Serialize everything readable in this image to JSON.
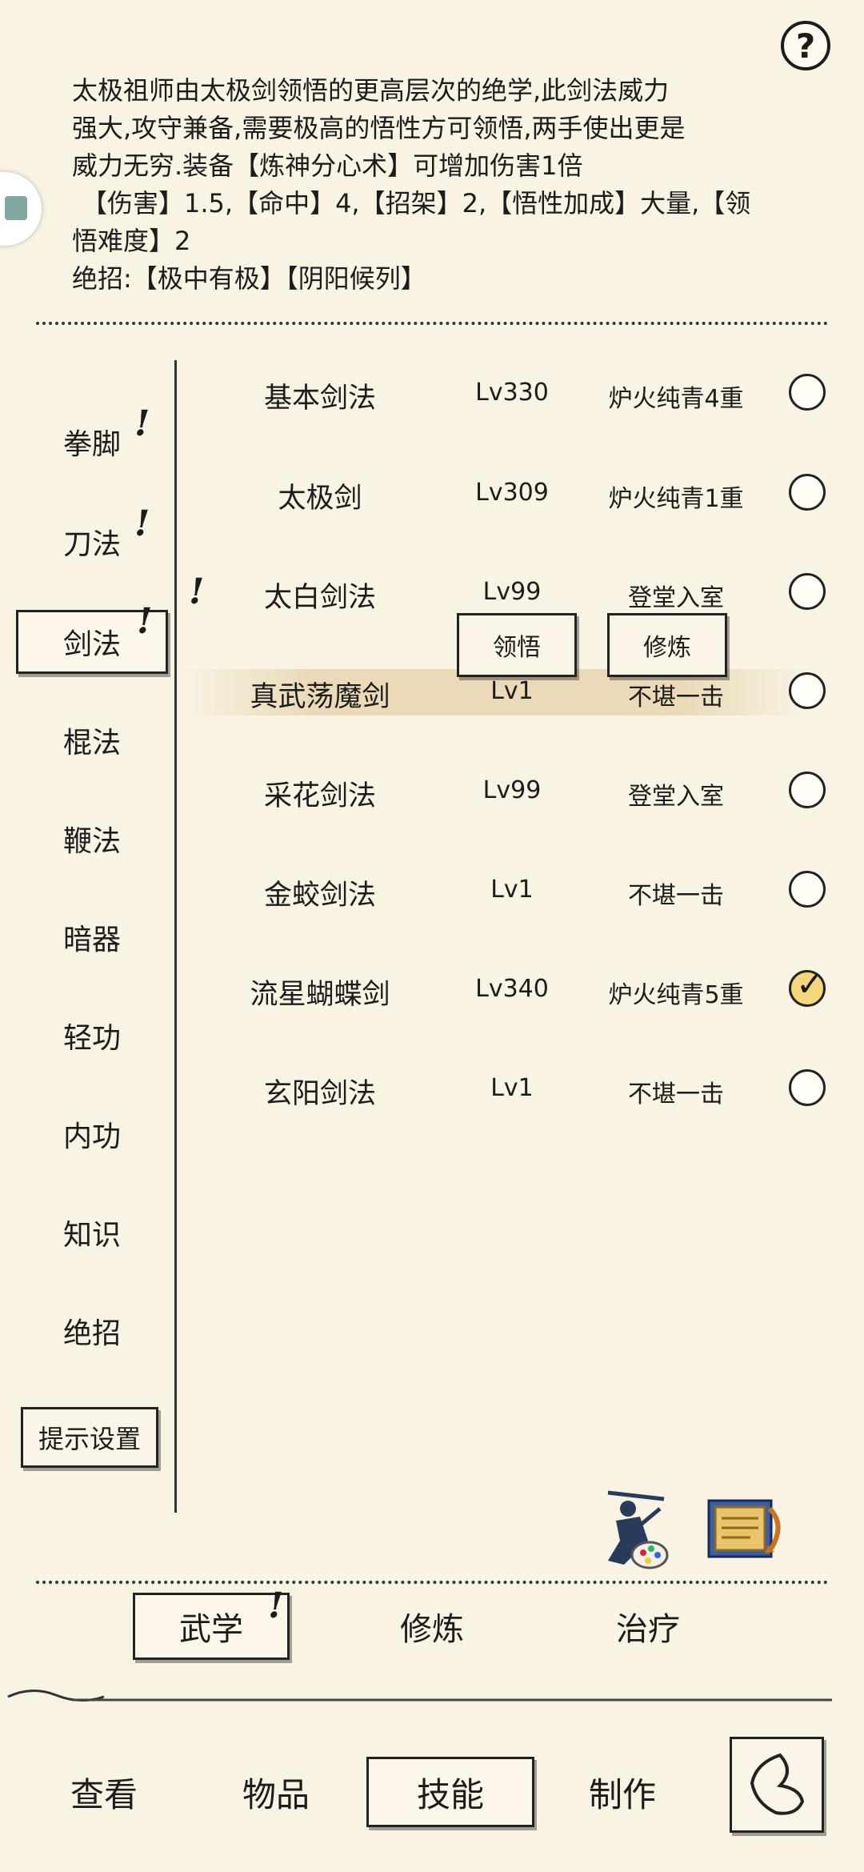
{
  "description": {
    "lines": [
      "太极祖师由太极剑领悟的更高层次的绝学,此剑法威力",
      "强大,攻守兼备,需要极高的悟性方可领悟,两手使出更是",
      "威力无穷.装备【炼神分心术】可增加伤害1倍",
      "【伤害】1.5,【命中】4,【招架】2,【悟性加成】大量,【领",
      "悟难度】2",
      "绝招:【极中有极】【阴阳候列】"
    ]
  },
  "help_label": "?",
  "nav": {
    "items": [
      {
        "label": "拳脚",
        "alert": "!"
      },
      {
        "label": "刀法",
        "alert": "!"
      },
      {
        "label": "剑法",
        "alert": "!",
        "active": true
      },
      {
        "label": "棍法"
      },
      {
        "label": "鞭法"
      },
      {
        "label": "暗器"
      },
      {
        "label": "轻功"
      },
      {
        "label": "内功"
      },
      {
        "label": "知识"
      },
      {
        "label": "绝招"
      }
    ],
    "tips_button": "提示设置"
  },
  "skills": [
    {
      "name": "基本剑法",
      "level": "Lv330",
      "stage": "炉火纯青4重",
      "equipped": false
    },
    {
      "name": "太极剑",
      "level": "Lv309",
      "stage": "炉火纯青1重",
      "equipped": false
    },
    {
      "name": "太白剑法",
      "level": "Lv99",
      "stage": "登堂入室",
      "equipped": false,
      "alert": "!"
    },
    {
      "name": "真武荡魔剑",
      "level": "Lv1",
      "stage": "不堪一击",
      "equipped": false,
      "highlighted": true
    },
    {
      "name": "采花剑法",
      "level": "Lv99",
      "stage": "登堂入室",
      "equipped": false
    },
    {
      "name": "金蛟剑法",
      "level": "Lv1",
      "stage": "不堪一击",
      "equipped": false
    },
    {
      "name": "流星蝴蝶剑",
      "level": "Lv340",
      "stage": "炉火纯青5重",
      "equipped": true
    },
    {
      "name": "玄阳剑法",
      "level": "Lv1",
      "stage": "不堪一击",
      "equipped": false
    }
  ],
  "actions": {
    "comprehend": "领悟",
    "practice": "修炼"
  },
  "sub_tabs": [
    {
      "label": "武学",
      "active": true,
      "alert": "!"
    },
    {
      "label": "修炼"
    },
    {
      "label": "治疗"
    }
  ],
  "main_tabs": [
    {
      "label": "查看"
    },
    {
      "label": "物品"
    },
    {
      "label": "技能",
      "active": true
    },
    {
      "label": "制作"
    }
  ],
  "icons": {
    "help": "question-mark-icon",
    "side": "side-tab-icon",
    "skill_art": "swordsman-icon",
    "skill_book": "scroll-book-icon",
    "back": "back-icon",
    "checkmark": "checkmark-icon"
  },
  "colors": {
    "background": "#f8f3e3",
    "checked": "#f5d77b",
    "ink": "#1c1c1c"
  }
}
